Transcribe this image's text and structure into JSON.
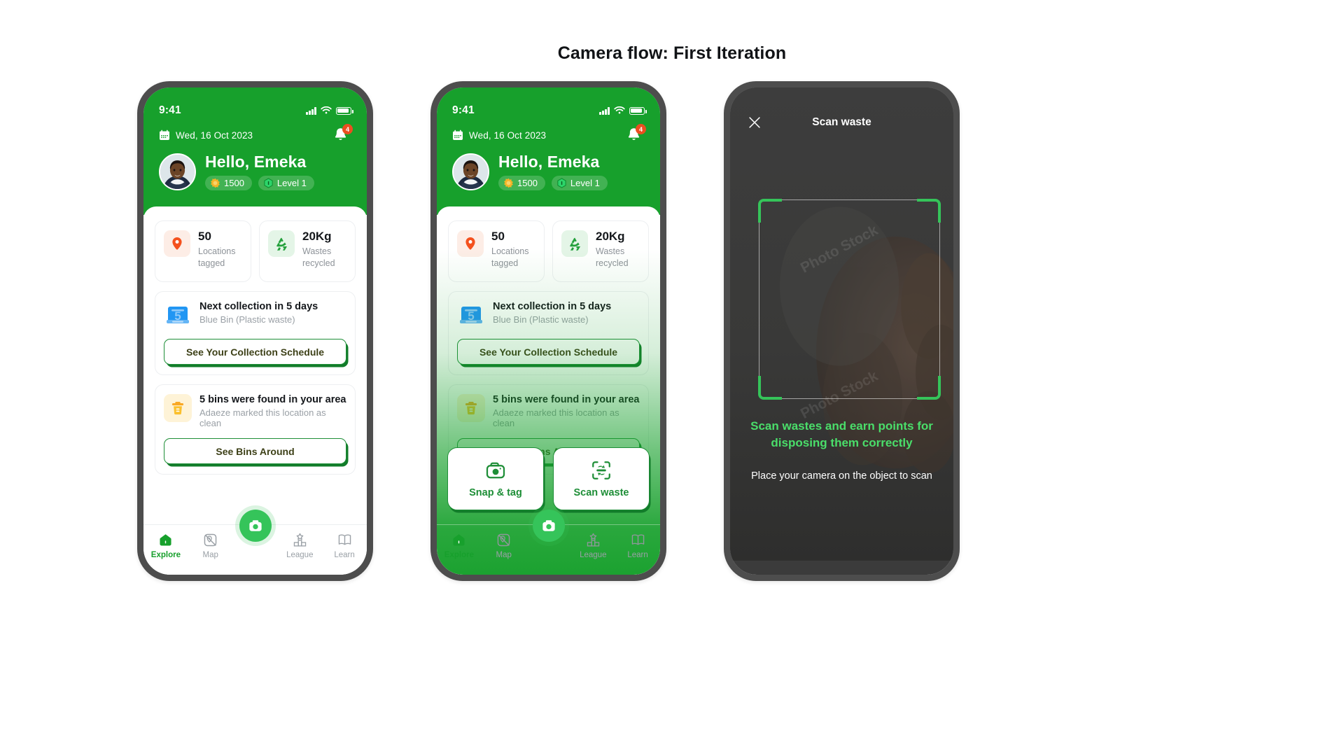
{
  "page": {
    "title": "Camera flow: First Iteration"
  },
  "colors": {
    "brand_green": "#17A02C",
    "accent_green": "#35C45A",
    "bright_green": "#4ADE6A",
    "badge_orange": "#EB4E20",
    "shell_gray": "#4D4D4D",
    "camera_bg": "#3B3B3B"
  },
  "status_bar": {
    "time": "9:41",
    "signal_icon": "signal-bars-icon",
    "wifi_icon": "wifi-icon",
    "battery_icon": "battery-icon"
  },
  "header": {
    "calendar_icon": "calendar-icon",
    "date": "Wed, 16 Oct 2023",
    "bell_icon": "bell-icon",
    "notification_count": "4",
    "avatar": "user-avatar",
    "greeting": "Hello, Emeka",
    "points_icon": "star-badge-icon",
    "points": "1500",
    "level_icon": "level-hexagon-icon",
    "level": "Level 1"
  },
  "stats": [
    {
      "icon": "location-pin-icon",
      "value": "50",
      "label": "Locations tagged"
    },
    {
      "icon": "recycle-icon",
      "value": "20Kg",
      "label": "Wastes recycled"
    }
  ],
  "collection_card": {
    "icon": "calendar-day-5-icon",
    "title": "Next collection in 5 days",
    "subtitle": "Blue Bin (Plastic waste)",
    "button": "See Your Collection Schedule"
  },
  "bins_card": {
    "icon": "trash-bin-icon",
    "title": "5 bins were found in your area",
    "subtitle": "Adaeze marked this location as clean",
    "button": "See Bins Around"
  },
  "tabs": [
    {
      "label": "Explore",
      "icon": "home-icon",
      "active": true
    },
    {
      "label": "Map",
      "icon": "map-icon",
      "active": false
    },
    {
      "label": "League",
      "icon": "podium-icon",
      "active": false
    },
    {
      "label": "Learn",
      "icon": "book-icon",
      "active": false
    }
  ],
  "fab": {
    "icon": "camera-icon"
  },
  "action_sheet": [
    {
      "icon": "camera-outline-icon",
      "label": "Snap & tag"
    },
    {
      "icon": "scan-waste-icon",
      "label": "Scan waste"
    }
  ],
  "camera_screen": {
    "close_icon": "close-icon",
    "title": "Scan waste",
    "headline": "Scan wastes and earn points for disposing them correctly",
    "subtext": "Place your camera on the object to scan"
  }
}
